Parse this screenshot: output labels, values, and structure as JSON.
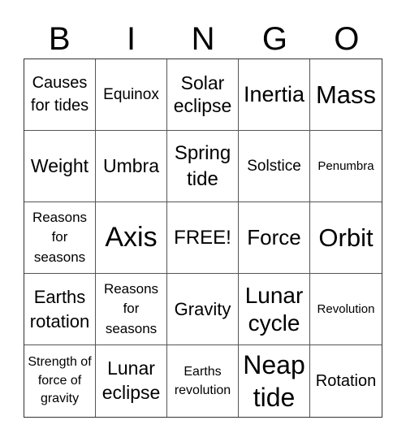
{
  "header": [
    "B",
    "I",
    "N",
    "G",
    "O"
  ],
  "cells": [
    "Causes for tides",
    "Equinox",
    "Solar eclipse",
    "Inertia",
    "Mass",
    "Weight",
    "Umbra",
    "Spring tide",
    "Solstice",
    "Penumbra",
    "Reasons for seasons",
    "Axis",
    "FREE!",
    "Force",
    "Orbit",
    "Earths rotation",
    "Reasons for seasons",
    "Gravity",
    "Lunar cycle",
    "Revolution",
    "Strength of force of gravity",
    "Lunar eclipse",
    "Earths revolution",
    "Neap tide",
    "Rotation"
  ]
}
